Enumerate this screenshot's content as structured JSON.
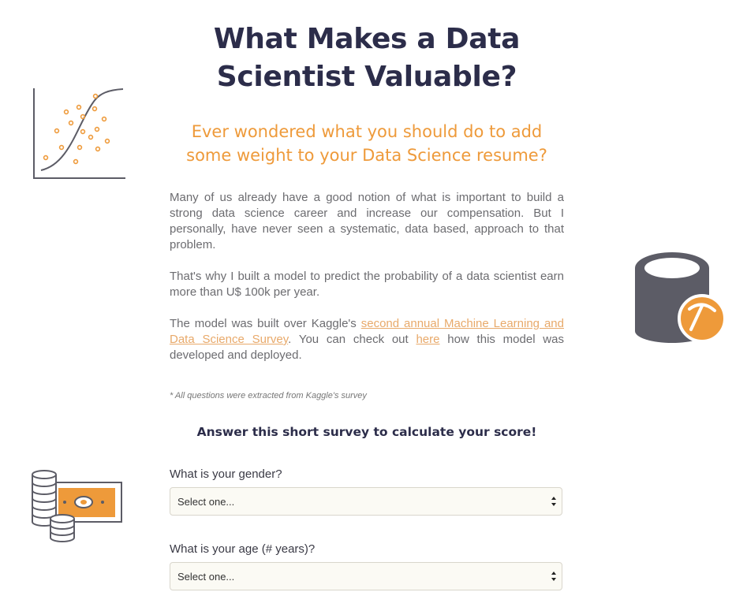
{
  "header": {
    "title_line1": "What Makes a Data",
    "title_line2": "Scientist Valuable?",
    "subtitle_line1": "Ever wondered what you should do to add",
    "subtitle_line2": "some weight to your Data Science resume?"
  },
  "intro": {
    "paragraph1": "Many of us already have a good notion of what is important to build a strong data science career and increase our compensation. But I personally, have never seen a systematic, data based, approach to that problem.",
    "paragraph2": "That's why I built a model to predict the probability of a data scientist earn more than U$ 100k per year.",
    "paragraph3_before": "The model was built over Kaggle's ",
    "survey_link": "second annual Machine Learning and Data Science Survey",
    "paragraph3_middle": ". You can check out ",
    "here_link": "here",
    "paragraph3_after": " how this model was developed and deployed."
  },
  "note": "* All questions were extracted from Kaggle's survey",
  "survey": {
    "heading": "Answer this short survey to calculate your score!",
    "questions": [
      {
        "label": "What is your gender?",
        "selected": "Select one..."
      },
      {
        "label": "What is your age (# years)?",
        "selected": "Select one..."
      }
    ]
  },
  "colors": {
    "title": "#2c2d4a",
    "accent": "#ee9a3a",
    "body_text": "#6c6c70",
    "link": "#e8a96a",
    "icon_gray": "#5c5c66"
  },
  "icons": [
    "scatter-plot-icon",
    "database-pickaxe-icon",
    "money-coins-icon",
    "select-arrows-icon"
  ]
}
